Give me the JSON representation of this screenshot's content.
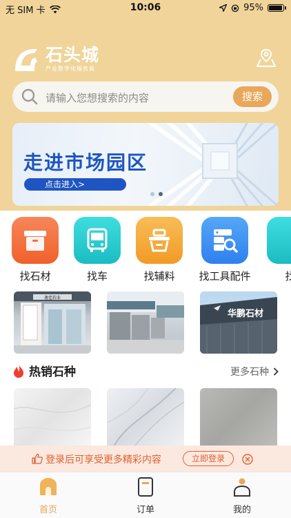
{
  "status_bar": {
    "carrier": "无 SIM 卡",
    "time": "10:06",
    "battery": "95%",
    "battery_level": 0.95
  },
  "header": {
    "logo_title": "石头城",
    "logo_subtitle": "产业数字化服务商",
    "map_icon": "map-pin-icon"
  },
  "search": {
    "placeholder": "请输入您想搜索的内容",
    "button_label": "搜索"
  },
  "banner": {
    "title": "走进市场园区",
    "button_label": "点击进入>",
    "slide_count": 2,
    "active_slide": 2
  },
  "categories": [
    {
      "label": "找石材",
      "icon": "box-icon",
      "color": "#f4733f"
    },
    {
      "label": "找车",
      "icon": "bus-icon",
      "color": "#22c7cc"
    },
    {
      "label": "找辅料",
      "icon": "basket-icon",
      "color": "#f2a83c"
    },
    {
      "label": "找工具配件",
      "icon": "tool-search-icon",
      "color": "#3c8df2"
    },
    {
      "label": "找",
      "icon": "partial-icon",
      "color": "#22c7cc"
    }
  ],
  "photo_row": {
    "shop_sign": "逸佳石业",
    "building_sign": "华鹏石材"
  },
  "hot_section": {
    "title": "热销石种",
    "more_label": "更多石种"
  },
  "login_prompt": {
    "text": "登录后可享受更多精彩内容",
    "button_label": "立即登录"
  },
  "tabbar": [
    {
      "label": "首页",
      "icon": "home-icon",
      "active": true
    },
    {
      "label": "订单",
      "icon": "order-icon",
      "active": false
    },
    {
      "label": "我的",
      "icon": "profile-icon",
      "active": false
    }
  ],
  "colors": {
    "header_bg": "#f0d49a",
    "accent": "#e8a75a",
    "banner_blue": "#1d56c4",
    "login_orange": "#e0612f"
  }
}
